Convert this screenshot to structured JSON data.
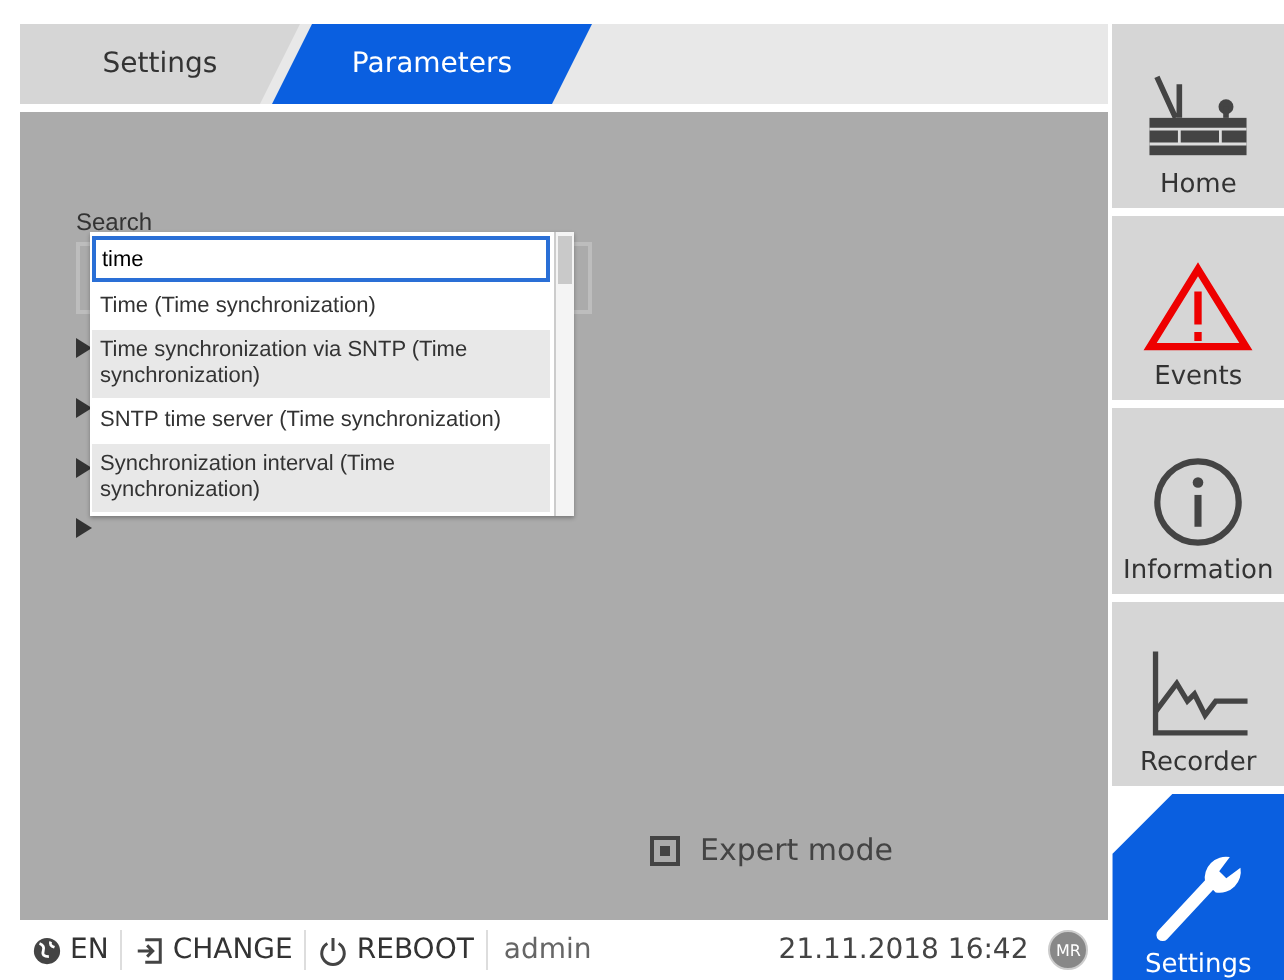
{
  "tabs": [
    {
      "label": "Settings",
      "selected": false
    },
    {
      "label": "Parameters",
      "selected": true
    }
  ],
  "search": {
    "label": "Search",
    "value": "time",
    "suggestions": [
      {
        "text": "Time (Time synchronization)",
        "highlighted": false
      },
      {
        "text": "Time synchronization via SNTP (Time synchronization)",
        "highlighted": true
      },
      {
        "text": "SNTP time server (Time synchronization)",
        "highlighted": false
      },
      {
        "text": "Synchronization interval (Time synchronization)",
        "highlighted": true
      }
    ]
  },
  "expert_mode": {
    "label": "Expert mode",
    "checked": true
  },
  "status_bar": {
    "language": "EN",
    "change": "CHANGE",
    "reboot": "REBOOT",
    "user": "admin",
    "datetime": "21.11.2018 16:42",
    "logo": "MR"
  },
  "sidebar": {
    "items": [
      {
        "kind": "home",
        "label": "Home",
        "selected": false
      },
      {
        "kind": "events",
        "label": "Events",
        "selected": false
      },
      {
        "kind": "information",
        "label": "Information",
        "selected": false
      },
      {
        "kind": "recorder",
        "label": "Recorder",
        "selected": false
      },
      {
        "kind": "settings",
        "label": "Settings",
        "selected": true
      }
    ]
  }
}
